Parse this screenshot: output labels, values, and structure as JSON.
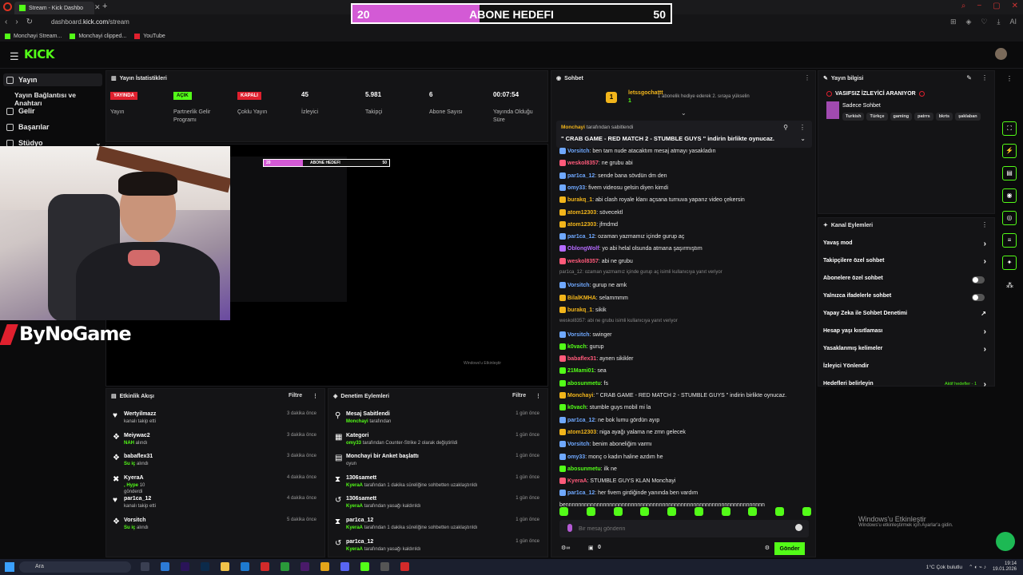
{
  "browser": {
    "tab_title": "Stream - Kick Dashbo",
    "url_prefix": "dashboard.",
    "url_domain": "kick.com",
    "url_path": "/stream",
    "bookmarks": [
      "Monchayi Stream...",
      "Monchayi clipped...",
      "YouTube"
    ],
    "ai_label": "AI"
  },
  "goal_overlay": {
    "current": "20",
    "target": "50",
    "label": "ABONE HEDEFI",
    "progress": 0.4
  },
  "kick": {
    "logo": "KICK"
  },
  "sidebar": {
    "items": [
      {
        "label": "Yayın"
      },
      {
        "label": "Yayın Bağlantısı ve Anahtarı"
      },
      {
        "label": "Gelir"
      },
      {
        "label": "Başarılar"
      },
      {
        "label": "Stüdyo"
      }
    ]
  },
  "stats": {
    "title": "Yayın İstatistikleri",
    "items": [
      {
        "value": "YAYINDA",
        "label": "Yayın",
        "kind": "red"
      },
      {
        "value": "AÇIK",
        "label": "Partnerlik Gelir Programı",
        "kind": "green"
      },
      {
        "value": "KAPALI",
        "label": "Çoklu Yayın",
        "kind": "red"
      },
      {
        "value": "45",
        "label": "İzleyici"
      },
      {
        "value": "5.981",
        "label": "Takipçi"
      },
      {
        "value": "6",
        "label": "Abone Sayısı"
      },
      {
        "value": "00:07:54",
        "label": "Yayında Olduğu Süre"
      }
    ]
  },
  "overlay_brand": "ByNoGame",
  "mini_goal": {
    "current": "20",
    "label": "ABONE HEDEFI",
    "target": "50"
  },
  "mini_windows_text": "Windows'u Etkinleştir",
  "activity_feed": {
    "title": "Etkinlik Akışı",
    "filter": "Filtre",
    "rows": [
      {
        "name": "Wertyilmazz",
        "sub": "kanalı takip etti",
        "time": "3 dakika önce",
        "icon": "heart-icon"
      },
      {
        "name": "Meiywac2",
        "sub_highlight": "NAH",
        "sub": "alındı",
        "time": "3 dakika önce",
        "icon": "gift-icon"
      },
      {
        "name": "babaflex31",
        "sub_highlight": "Su iç",
        "sub": "alındı",
        "time": "3 dakika önce",
        "icon": "gift-icon"
      },
      {
        "name": "KyeraA",
        "sub_highlight": ", Hype",
        "sub": "10",
        "extra": "gönderdi",
        "time": "4 dakika önce",
        "icon": "x-icon"
      },
      {
        "name": "par1ca_12",
        "sub": "kanalı takip etti",
        "time": "4 dakika önce",
        "icon": "heart-icon"
      },
      {
        "name": "Vorsitch",
        "sub_highlight": "Su iç",
        "sub": "alındı",
        "time": "5 dakika önce",
        "icon": "gift-icon"
      }
    ]
  },
  "moderation": {
    "title": "Denetim Eylemleri",
    "filter": "Filtre",
    "rows": [
      {
        "name": "Mesaj Sabitlendi",
        "sub_highlight": "Monchayi",
        "sub": "tarafından",
        "time": "1 gün önce",
        "icon": "pin-icon"
      },
      {
        "name": "Kategori",
        "sub_highlight": "omy33",
        "sub": "tarafından Counter-Strike 2 olarak değiştirildi",
        "time": "1 gün önce",
        "icon": "category-icon"
      },
      {
        "name": "Monchayi bir Anket başlattı",
        "sub": "oyun",
        "time": "1 gün önce",
        "icon": "poll-icon"
      },
      {
        "name": "1306samett",
        "sub_highlight": "KyeraA",
        "sub": "tarafından 1 dakika süreliğine sohbetten uzaklaştırıldı",
        "time": "1 gün önce",
        "icon": "timeout-icon"
      },
      {
        "name": "1306samett",
        "sub_highlight": "KyeraA",
        "sub": "tarafından yasağı kaldırıldı",
        "time": "1 gün önce",
        "icon": "unban-icon"
      },
      {
        "name": "par1ca_12",
        "sub_highlight": "KyeraA",
        "sub": "tarafından 1 dakika süreliğine sohbetten uzaklaştırıldı",
        "time": "1 gün önce",
        "icon": "timeout-icon"
      },
      {
        "name": "par1ca_12",
        "sub_highlight": "KyeraA",
        "sub": "tarafından yasağı kaldırıldı",
        "time": "1 gün önce",
        "icon": "unban-icon"
      }
    ]
  },
  "chat": {
    "title": "Sohbet",
    "top_gifter": {
      "rank": "1",
      "name": "letssgochattt",
      "count": "1",
      "text": "1 abonelik hediye ederek 2. sıraya yükselin"
    },
    "pinned": {
      "by": "Monchayi",
      "by_suffix": "tarafından sabitlendi",
      "message": "\" CRAB GAME - RED MATCH 2 - STUMBLE GUYS \" indirin birlikte oynucaz."
    },
    "messages": [
      {
        "user": "Vorsitch",
        "color": "#6fa8ff",
        "text": ": ben tam nude atacaktım mesaj atmayı yasakladın"
      },
      {
        "user": "weskol8357",
        "color": "#ff5a7a",
        "text": ": ne grubu abi"
      },
      {
        "user": "par1ca_12",
        "color": "#6fa8ff",
        "text": ": sende bana sövdün dm den"
      },
      {
        "user": "omy33",
        "color": "#6fa8ff",
        "text": ": fivem videosu gelsin diyen kimdi"
      },
      {
        "user": "burakq_1",
        "color": "#f2b51b",
        "text": ": abi clash royale klanı açsana turnuva yaparız video çekersin"
      },
      {
        "user": "atom12303",
        "color": "#f2b51b",
        "text": ": sövecektl"
      },
      {
        "user": "atom12303",
        "color": "#f2b51b",
        "text": ": jfmdmd"
      },
      {
        "user": "par1ca_12",
        "color": "#6fa8ff",
        "text": ": ozaman yazmamız içinde gurup aç"
      },
      {
        "user": "OblongWolf",
        "color": "#b56aff",
        "text": ": yo abi helal olsunda atmana şaşırmıştım"
      },
      {
        "user": "weskol8357",
        "color": "#ff5a7a",
        "text": ": abi ne grubu"
      },
      {
        "reply": "par1ca_12: ozaman yazmamız içinde gurup aç isimli kullanıcıya yanıt veriyor"
      },
      {
        "user": "Vorsitch",
        "color": "#6fa8ff",
        "text": ": gurup ne amk"
      },
      {
        "user": "BilalKMHA",
        "color": "#f2b51b",
        "text": ": selammmm"
      },
      {
        "user": "burakq_1",
        "color": "#f2b51b",
        "text": ": sikik"
      },
      {
        "reply": "weskol8357: abi ne grubu isimli kullanıcıya yanıt veriyor"
      },
      {
        "user": "Vorsitch",
        "color": "#6fa8ff",
        "text": ": swinger"
      },
      {
        "user": "k0vach",
        "color": "#53fc18",
        "text": ": gurup"
      },
      {
        "user": "babaflex31",
        "color": "#ff5a7a",
        "text": ": aynen sikikler"
      },
      {
        "user": "21Mami01",
        "color": "#53fc18",
        "text": ": sea"
      },
      {
        "user": "abosunmetu",
        "color": "#53fc18",
        "text": ": fs"
      },
      {
        "user": "Monchayi",
        "color": "#f2b51b",
        "text": ": \" CRAB GAME - RED MATCH 2 - STUMBLE GUYS \" indirin birlikte oynucaz."
      },
      {
        "user": "k0vach",
        "color": "#53fc18",
        "text": ": stumble guys mobil mi la"
      },
      {
        "user": "par1ca_12",
        "color": "#6fa8ff",
        "text": ": ne bok lumu gördün ayıp"
      },
      {
        "user": "atom12303",
        "color": "#f2b51b",
        "text": ": niga ayağı yalama ne zmn gelecek"
      },
      {
        "user": "Vorsitch",
        "color": "#6fa8ff",
        "text": ": benim aboneliğim varmı"
      },
      {
        "user": "omy33",
        "color": "#6fa8ff",
        "text": ": monç o kadın haline azdım he"
      },
      {
        "user": "abosunmetu",
        "color": "#53fc18",
        "text": ": ilk ne"
      },
      {
        "user": "KyeraA",
        "color": "#ff5a7a",
        "text": ": STUMBLE GUYS KLAN Monchayi"
      },
      {
        "user": "par1ca_12",
        "color": "#6fa8ff",
        "text": ": her fivem girdiğinde yanında ben vardım"
      },
      {
        "user": "",
        "color": "#e8e8e8",
        "text": "bennnnnnnnnnnnnnnnnnnnnnnnnnnnnnnnnnnnnnnnnnnnnnnnnnnnnnnnnnnnnnnn"
      }
    ],
    "input_placeholder": "Bir mesaj gönderin",
    "send_label": "Gönder",
    "points": "0"
  },
  "stream_info": {
    "title": "Yayın bilgisi",
    "stream_title": "VASIFSIZ İZLEYİCİ ARANIYOR",
    "category": "Sadece Sohbet",
    "tags": [
      "Turkish",
      "Türkçe",
      "gaming",
      "patrrs",
      "bkrts",
      "şaklaban"
    ]
  },
  "channel_actions": {
    "title": "Kanal Eylemleri",
    "rows": [
      {
        "label": "Yavaş mod",
        "control": "chevron"
      },
      {
        "label": "Takipçilere özel sohbet",
        "control": "chevron"
      },
      {
        "label": "Abonelere özel sohbet",
        "control": "toggle"
      },
      {
        "label": "Yalnızca ifadelerle sohbet",
        "control": "toggle"
      },
      {
        "label": "Yapay Zeka ile Sohbet Denetimi",
        "control": "external"
      },
      {
        "label": "Hesap yaşı kısıtlaması",
        "control": "chevron"
      },
      {
        "label": "Yasaklanmış kelimeler",
        "control": "chevron"
      },
      {
        "label": "İzleyici Yönlendir",
        "control": "none"
      },
      {
        "label": "Hedefleri belirleyin",
        "control": "chevron",
        "badge": "Aktif hedefler - 1"
      }
    ]
  },
  "windows_activation": {
    "title": "Windows'u Etkinleştir",
    "sub": "Windows'u etkinleştirmek için Ayarlar'a gidin."
  },
  "taskbar": {
    "search": "Ara",
    "weather": "1°C  Çok bulutlu",
    "time": "19:14",
    "date": "19.01.2026"
  },
  "colors": {
    "accent": "#53fc18",
    "live_red": "#e0202e",
    "goal_pink": "#d35ad5",
    "panel_bg": "#141416"
  }
}
